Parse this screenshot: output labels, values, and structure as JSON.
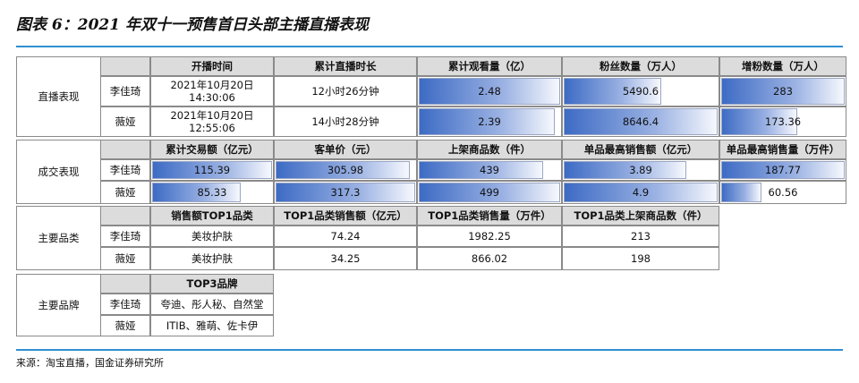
{
  "title": "图表 6：2021 年双十一预售首日头部主播直播表现",
  "source": "来源：淘宝直播，国金证券研究所",
  "streamers": [
    "李佳琦",
    "薇娅"
  ],
  "section1": {
    "label": "直播表现",
    "headers": [
      "开播时间",
      "累计直播时长",
      "累计观看量（亿）",
      "粉丝数量（万人）",
      "增粉数量（万人）"
    ],
    "rows": [
      {
        "start_date": "2021年10月20日",
        "start_time": "14:30:06",
        "duration": "12小时26分钟",
        "views": "2.48",
        "fans": "5490.6",
        "new_fans": "283"
      },
      {
        "start_date": "2021年10月20日",
        "start_time": "12:55:06",
        "duration": "14小时28分钟",
        "views": "2.39",
        "fans": "8646.4",
        "new_fans": "173.36"
      }
    ]
  },
  "section2": {
    "label": "成交表现",
    "headers": [
      "累计交易额（亿元）",
      "客单价（元）",
      "上架商品数（件）",
      "单品最高销售额（亿元）",
      "单品最高销售量（万件）"
    ],
    "rows": [
      [
        "115.39",
        "305.98",
        "439",
        "3.89",
        "187.77"
      ],
      [
        "85.33",
        "317.3",
        "499",
        "4.9",
        "60.56"
      ]
    ]
  },
  "section3": {
    "label": "主要品类",
    "headers": [
      "销售额TOP1品类",
      "TOP1品类销售额（亿元）",
      "TOP1品类销售量（万件）",
      "TOP1品类上架商品数（件）"
    ],
    "rows": [
      [
        "美妆护肤",
        "74.24",
        "1982.25",
        "213"
      ],
      [
        "美妆护肤",
        "34.25",
        "866.02",
        "198"
      ]
    ]
  },
  "section4": {
    "label": "主要品牌",
    "headers": [
      "TOP3品牌"
    ],
    "rows": [
      [
        "夸迪、彤人秘、自然堂"
      ],
      [
        "ITIB、雅萌、佐卡伊"
      ]
    ]
  }
}
